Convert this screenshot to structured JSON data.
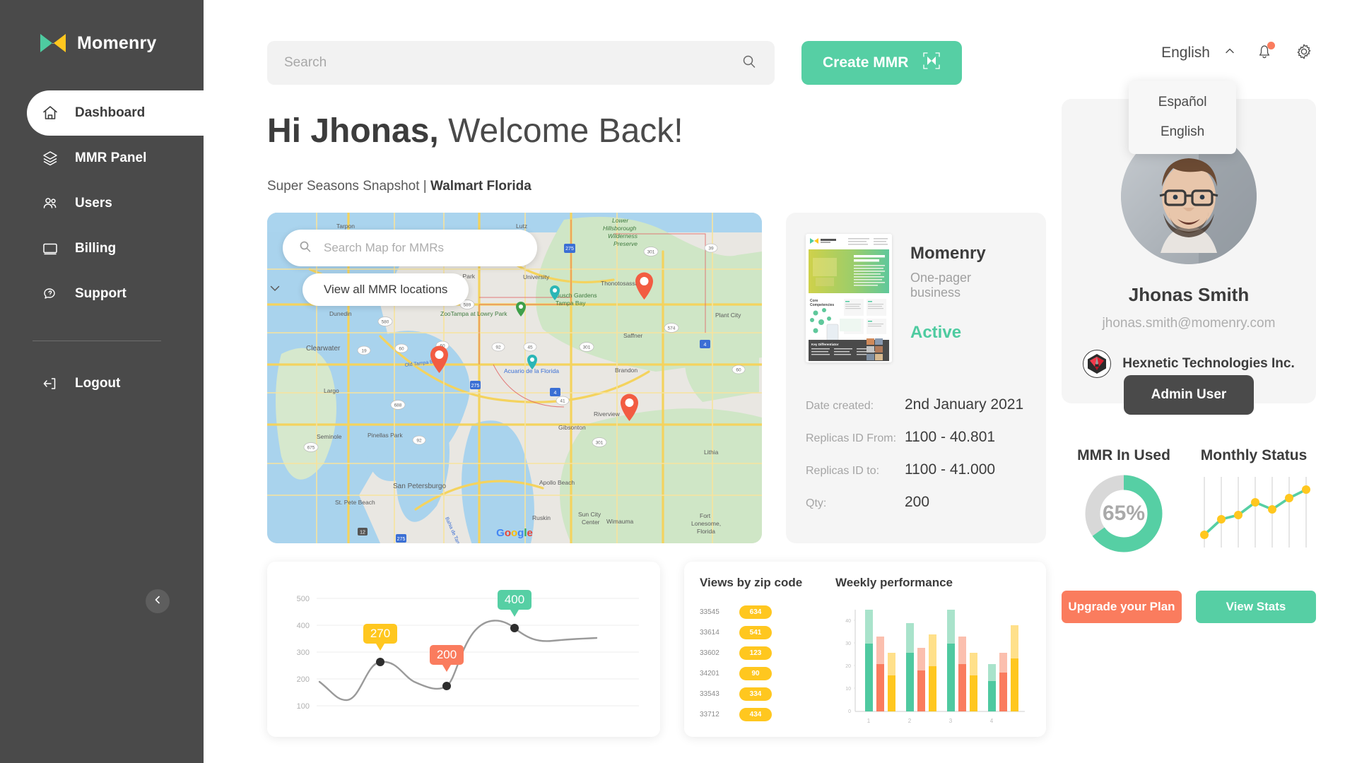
{
  "brand": {
    "name": "Momenry",
    "logo_icon": "momenry-logo-icon"
  },
  "sidebar": {
    "items": [
      {
        "label": "Dashboard",
        "icon": "home-icon",
        "active": true
      },
      {
        "label": "MMR Panel",
        "icon": "layers-icon",
        "active": false
      },
      {
        "label": "Users",
        "icon": "users-icon",
        "active": false
      },
      {
        "label": "Billing",
        "icon": "card-icon",
        "active": false
      },
      {
        "label": "Support",
        "icon": "chat-question-icon",
        "active": false
      }
    ],
    "logout": {
      "label": "Logout",
      "icon": "logout-icon"
    },
    "collapse_icon": "chevron-left-icon"
  },
  "topbar": {
    "search": {
      "placeholder": "Search",
      "value": "",
      "icon": "search-icon"
    },
    "create_button": {
      "label": "Create MMR",
      "icon": "mmr-frame-icon"
    },
    "language": {
      "selected": "English",
      "chevron_icon": "chevron-up-icon",
      "options": [
        "Español",
        "English"
      ]
    },
    "notifications_icon": "bell-icon",
    "has_notification": true,
    "settings_icon": "gear-icon"
  },
  "page": {
    "greeting_bold": "Hi Jhonas,",
    "greeting_rest": "Welcome Back!",
    "subhead_normal": "Super Seasons Snapshot | ",
    "subhead_bold": "Walmart Florida"
  },
  "map": {
    "search_placeholder": "Search Map for MMRs",
    "search_icon": "search-icon",
    "view_all_label": "View all MMR locations",
    "expand_icon": "chevron-down-icon",
    "attribution": "Google",
    "pin_count": 3,
    "labels": [
      "Tarpon",
      "Lutz",
      "Lower Hillsborough Wilderness Preserve",
      "Citrus Park",
      "University",
      "Thonotosassa",
      "Busch Gardens Tampa Bay",
      "ZooTampa at Lowry Park",
      "Plant City",
      "Dunedin",
      "Saffner",
      "Clearwater",
      "Old Tampa Bay",
      "Brandon",
      "Acuario de la Florida",
      "Largo",
      "Riverview",
      "Seminole",
      "Pinellas Park",
      "Gibsonton",
      "Lithia",
      "San Petersburgo",
      "Apollo Beach",
      "St. Pete Beach",
      "Ruskin",
      "Sun City Center",
      "Wimauma",
      "Fort Lonesome, Florida",
      "Bahia de Tampa"
    ]
  },
  "mmr_detail": {
    "title": "Momenry",
    "subtitle": "One-pager business",
    "status": "Active",
    "status_color": "#4ECBA0",
    "rows": [
      {
        "key": "Date created:",
        "value": "2nd January 2021"
      },
      {
        "key": "Replicas ID From:",
        "value": "1100 - 40.801"
      },
      {
        "key": "Replicas ID to:",
        "value": "1100 - 41.000"
      },
      {
        "key": "Qty:",
        "value": "200"
      }
    ]
  },
  "profile": {
    "avatar_icon": "user-avatar",
    "name": "Jhonas Smith",
    "email": "jhonas.smith@momenry.com",
    "org_name": "Hexnetic Technologies Inc.",
    "org_logo_icon": "hexnetic-logo-icon",
    "role_button": "Admin User"
  },
  "stats": {
    "mmr_in_used": {
      "title": "MMR In Used",
      "percent": 65,
      "label": "65%",
      "color": "#56CFA4",
      "track": "#D8D8D8"
    },
    "monthly_status": {
      "title": "Monthly Status"
    },
    "actions": {
      "upgrade": {
        "label": "Upgrade your Plan",
        "color": "#FA7C5E"
      },
      "stats": {
        "label": "View Stats",
        "color": "#56CFA4"
      }
    }
  },
  "panels": {
    "views_by_zip_title": "Views by zip code",
    "weekly_performance_title": "Weekly performance"
  },
  "chart_data": [
    {
      "type": "line",
      "title": "",
      "xlabel": "",
      "ylabel": "",
      "ylim": [
        50,
        550
      ],
      "yticks": [
        100,
        200,
        300,
        400,
        500
      ],
      "grid": true,
      "x": [
        0,
        1,
        2,
        3,
        4,
        5,
        6
      ],
      "values": [
        215,
        162,
        270,
        220,
        190,
        405,
        358
      ],
      "annotations": [
        {
          "x": 2,
          "y": 270,
          "label": "270",
          "color": "#FFC71F"
        },
        {
          "x": 4,
          "y": 190,
          "label": "200",
          "color": "#FA7C5E"
        },
        {
          "x": 5,
          "y": 405,
          "label": "400",
          "color": "#56CFA4"
        }
      ],
      "line_color": "#9A9A9A",
      "marker_color": "#2D2D2D"
    },
    {
      "type": "bar",
      "title": "Views by zip code",
      "categories": [
        "33545",
        "33614",
        "33602",
        "34201",
        "33543",
        "33712"
      ],
      "values": [
        634,
        541,
        123,
        90,
        334,
        434
      ],
      "color": "#FFC71F",
      "xlabel": "",
      "ylabel": ""
    },
    {
      "type": "bar",
      "title": "Weekly performance",
      "categories": [
        "1",
        "2",
        "3",
        "4"
      ],
      "yticks": [
        0,
        10,
        20,
        30,
        40
      ],
      "ylim": [
        0,
        48
      ],
      "xlabel": "",
      "ylabel": "",
      "series": [
        {
          "name": "green-total",
          "color": "#A9E3CB",
          "values": [
            45,
            39,
            45,
            21
          ]
        },
        {
          "name": "green-solid",
          "color": "#4FC9A0",
          "values": [
            30,
            26,
            30,
            14
          ]
        },
        {
          "name": "red-total",
          "color": "#FBBFAE",
          "values": [
            33,
            28,
            33,
            26
          ]
        },
        {
          "name": "red-solid",
          "color": "#FA7C5E",
          "values": [
            21,
            18,
            21,
            17
          ]
        },
        {
          "name": "yellow-total",
          "color": "#FFE08A",
          "values": [
            26,
            34,
            26,
            42
          ]
        },
        {
          "name": "yellow-solid",
          "color": "#FFC71F",
          "values": [
            16,
            20,
            16,
            25
          ]
        }
      ]
    },
    {
      "type": "line",
      "title": "Monthly Status",
      "grid": true,
      "x": [
        1,
        2,
        3,
        4,
        5,
        6,
        7
      ],
      "values": [
        10,
        32,
        38,
        52,
        44,
        56,
        68
      ],
      "line_color": "#56CFA4",
      "marker_color": "#FFC71F",
      "xlabel": "",
      "ylabel": ""
    }
  ]
}
